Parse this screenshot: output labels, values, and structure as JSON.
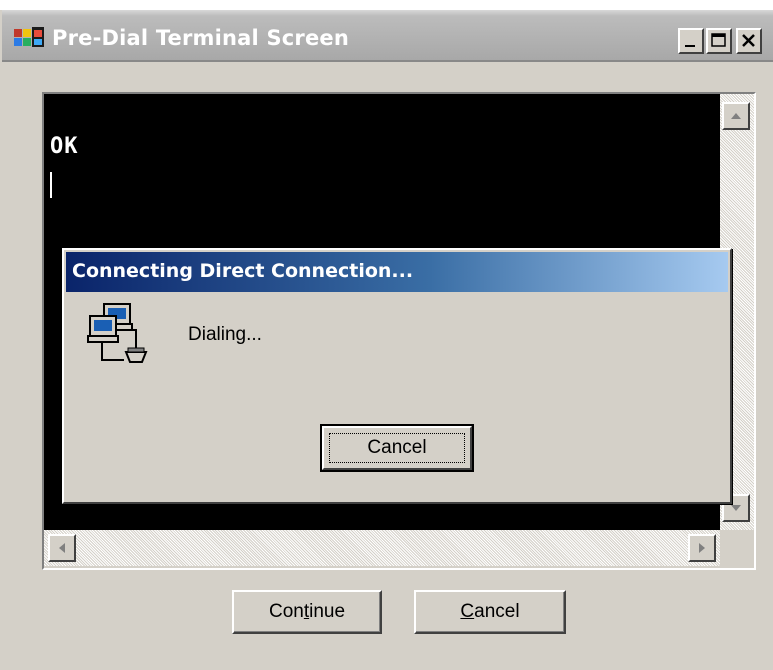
{
  "window": {
    "title": "Pre-Dial Terminal Screen",
    "icon": "terminal-window-icon",
    "controls": [
      "minimize-icon",
      "maximize-icon",
      "close-icon"
    ]
  },
  "terminal": {
    "lines": [
      "OK"
    ]
  },
  "buttons": {
    "continue_label": "Continue",
    "continue_mnemonic": "t",
    "cancel_label": "Cancel",
    "cancel_mnemonic": "C"
  },
  "dialog": {
    "title": "Connecting Direct Connection...",
    "status": "Dialing...",
    "cancel_label": "Cancel",
    "icon": "network-computers-icon"
  },
  "colors": {
    "window_bg": "#d4d0c8",
    "terminal_bg": "#000000",
    "terminal_fg": "#ffffff",
    "dialog_title_start": "#0a246a",
    "dialog_title_end": "#a6caf0",
    "inactive_title": "#a8a8a8"
  }
}
